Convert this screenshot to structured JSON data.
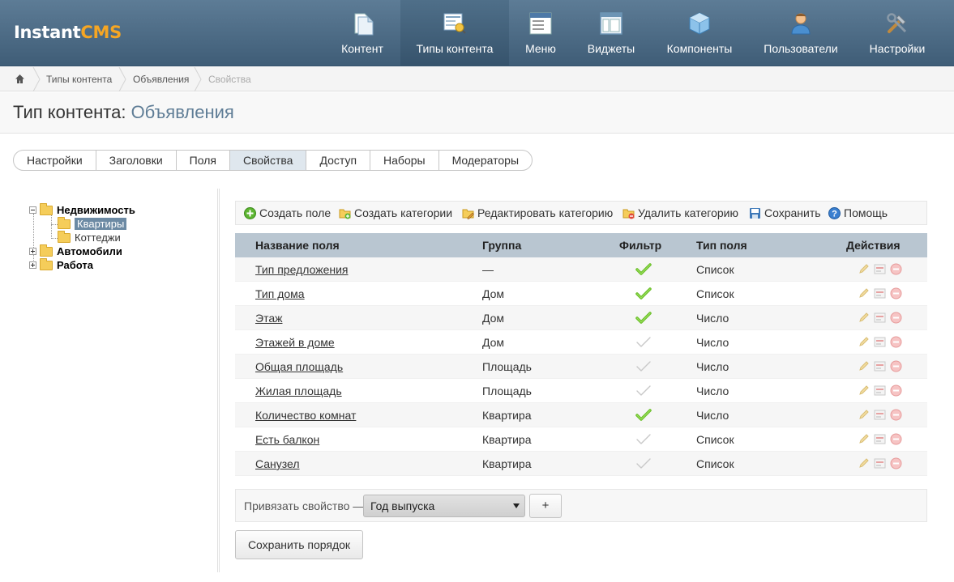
{
  "logo": {
    "part1": "Instant",
    "part2": "CMS"
  },
  "nav": [
    {
      "label": "Контент",
      "icon": "document-icon"
    },
    {
      "label": "Типы контента",
      "icon": "content-types-icon"
    },
    {
      "label": "Меню",
      "icon": "menu-icon"
    },
    {
      "label": "Виджеты",
      "icon": "widgets-icon"
    },
    {
      "label": "Компоненты",
      "icon": "components-icon"
    },
    {
      "label": "Пользователи",
      "icon": "user-icon"
    },
    {
      "label": "Настройки",
      "icon": "settings-icon"
    }
  ],
  "breadcrumb": [
    "Типы контента",
    "Объявления",
    "Свойства"
  ],
  "page": {
    "title": "Тип контента:",
    "subtitle": "Объявления"
  },
  "tabs": [
    "Настройки",
    "Заголовки",
    "Поля",
    "Свойства",
    "Доступ",
    "Наборы",
    "Модераторы"
  ],
  "active_tab": "Свойства",
  "tree": [
    {
      "label": "Недвижимость",
      "bold": true,
      "expanded": true
    },
    {
      "label": "Квартиры",
      "selected": true
    },
    {
      "label": "Коттеджи"
    },
    {
      "label": "Автомобили",
      "bold": true,
      "expanded": false
    },
    {
      "label": "Работа",
      "bold": true,
      "expanded": false
    }
  ],
  "toolbar": [
    {
      "label": "Создать поле",
      "icon": "add-icon"
    },
    {
      "label": "Создать категории",
      "icon": "folder-add-icon"
    },
    {
      "label": "Редактировать категорию",
      "icon": "folder-edit-icon"
    },
    {
      "label": "Удалить категорию",
      "icon": "folder-delete-icon"
    },
    {
      "label": "Сохранить",
      "icon": "save-icon"
    },
    {
      "label": "Помощь",
      "icon": "help-icon"
    }
  ],
  "table": {
    "headers": [
      "Название поля",
      "Группа",
      "Фильтр",
      "Тип поля",
      "Действия"
    ],
    "rows": [
      {
        "name": "Тип предложения",
        "group": "—",
        "filter": true,
        "type": "Список"
      },
      {
        "name": "Тип дома",
        "group": "Дом",
        "filter": true,
        "type": "Список"
      },
      {
        "name": "Этаж",
        "group": "Дом",
        "filter": true,
        "type": "Число"
      },
      {
        "name": "Этажей в доме",
        "group": "Дом",
        "filter": false,
        "type": "Число"
      },
      {
        "name": "Общая площадь",
        "group": "Площадь",
        "filter": false,
        "type": "Число"
      },
      {
        "name": "Жилая площадь",
        "group": "Площадь",
        "filter": false,
        "type": "Число"
      },
      {
        "name": "Количество комнат",
        "group": "Квартира",
        "filter": true,
        "type": "Число"
      },
      {
        "name": "Есть балкон",
        "group": "Квартира",
        "filter": false,
        "type": "Список"
      },
      {
        "name": "Санузел",
        "group": "Квартира",
        "filter": false,
        "type": "Список"
      }
    ]
  },
  "bind": {
    "label": "Привязать свойство —",
    "selected": "Год выпуска",
    "add_label": "+"
  },
  "save_order_label": "Сохранить порядок",
  "colors": {
    "header_bg": "#4f6f89",
    "accent": "#f6a623",
    "check_on": "#6bbf2a",
    "check_off": "#c8c8c8"
  }
}
